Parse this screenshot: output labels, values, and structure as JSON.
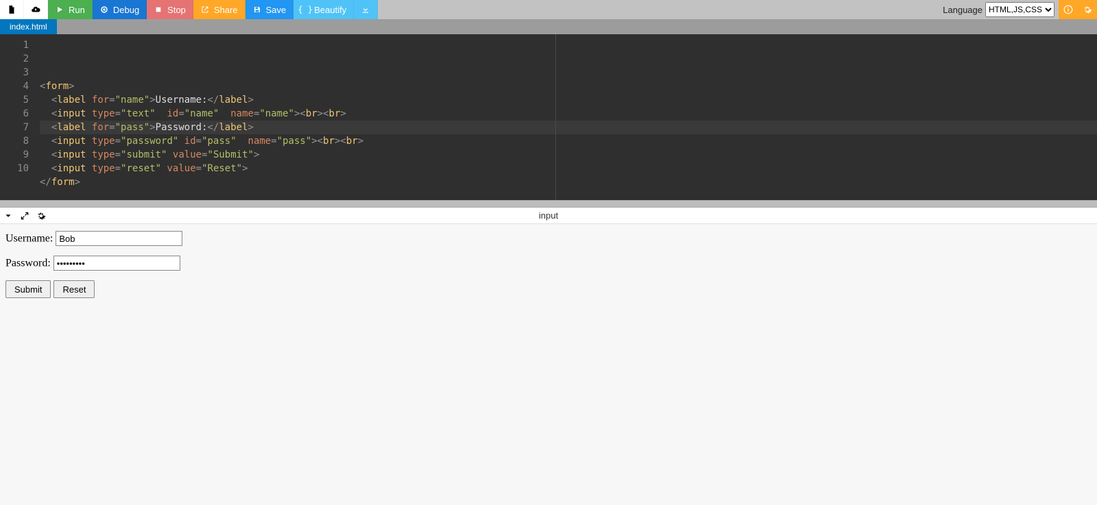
{
  "toolbar": {
    "run": "Run",
    "debug": "Debug",
    "stop": "Stop",
    "share": "Share",
    "save": "Save",
    "beautify": "Beautify",
    "language_label": "Language",
    "language_value": "HTML,JS,CSS"
  },
  "tab": {
    "filename": "index.html"
  },
  "editor": {
    "lines": [
      "1",
      "2",
      "3",
      "4",
      "5",
      "6",
      "7",
      "8",
      "9",
      "10"
    ],
    "code": [
      [
        [
          "t-punc",
          "<"
        ],
        [
          "t-tag",
          "form"
        ],
        [
          "t-punc",
          ">"
        ]
      ],
      [
        [
          "t-text",
          "  "
        ],
        [
          "t-punc",
          "<"
        ],
        [
          "t-tag",
          "label"
        ],
        [
          "t-text",
          " "
        ],
        [
          "t-attr",
          "for"
        ],
        [
          "t-punc",
          "="
        ],
        [
          "t-str",
          "\"name\""
        ],
        [
          "t-punc",
          ">"
        ],
        [
          "t-text",
          "Username:"
        ],
        [
          "t-punc",
          "</"
        ],
        [
          "t-tag",
          "label"
        ],
        [
          "t-punc",
          ">"
        ]
      ],
      [
        [
          "t-text",
          "  "
        ],
        [
          "t-punc",
          "<"
        ],
        [
          "t-tag",
          "input"
        ],
        [
          "t-text",
          " "
        ],
        [
          "t-attr",
          "type"
        ],
        [
          "t-punc",
          "="
        ],
        [
          "t-str",
          "\"text\""
        ],
        [
          "t-text",
          "  "
        ],
        [
          "t-attr",
          "id"
        ],
        [
          "t-punc",
          "="
        ],
        [
          "t-str",
          "\"name\""
        ],
        [
          "t-text",
          "  "
        ],
        [
          "t-attr",
          "name"
        ],
        [
          "t-punc",
          "="
        ],
        [
          "t-str",
          "\"name\""
        ],
        [
          "t-punc",
          "><"
        ],
        [
          "t-tag",
          "br"
        ],
        [
          "t-punc",
          "><"
        ],
        [
          "t-tag",
          "br"
        ],
        [
          "t-punc",
          ">"
        ]
      ],
      [
        [
          "t-text",
          "  "
        ],
        [
          "t-punc",
          "<"
        ],
        [
          "t-tag",
          "label"
        ],
        [
          "t-text",
          " "
        ],
        [
          "t-attr",
          "for"
        ],
        [
          "t-punc",
          "="
        ],
        [
          "t-str",
          "\"pass\""
        ],
        [
          "t-punc",
          ">"
        ],
        [
          "t-text",
          "Password:"
        ],
        [
          "t-punc",
          "</"
        ],
        [
          "t-tag",
          "label"
        ],
        [
          "t-punc",
          ">"
        ]
      ],
      [
        [
          "t-text",
          "  "
        ],
        [
          "t-punc",
          "<"
        ],
        [
          "t-tag",
          "input"
        ],
        [
          "t-text",
          " "
        ],
        [
          "t-attr",
          "type"
        ],
        [
          "t-punc",
          "="
        ],
        [
          "t-str",
          "\"password\""
        ],
        [
          "t-text",
          " "
        ],
        [
          "t-attr",
          "id"
        ],
        [
          "t-punc",
          "="
        ],
        [
          "t-str",
          "\"pass\""
        ],
        [
          "t-text",
          "  "
        ],
        [
          "t-attr",
          "name"
        ],
        [
          "t-punc",
          "="
        ],
        [
          "t-str",
          "\"pass\""
        ],
        [
          "t-punc",
          "><"
        ],
        [
          "t-tag",
          "br"
        ],
        [
          "t-punc",
          "><"
        ],
        [
          "t-tag",
          "br"
        ],
        [
          "t-punc",
          ">"
        ]
      ],
      [
        [
          "t-text",
          "  "
        ],
        [
          "t-punc",
          "<"
        ],
        [
          "t-tag",
          "input"
        ],
        [
          "t-text",
          " "
        ],
        [
          "t-attr",
          "type"
        ],
        [
          "t-punc",
          "="
        ],
        [
          "t-str",
          "\"submit\""
        ],
        [
          "t-text",
          " "
        ],
        [
          "t-attr",
          "value"
        ],
        [
          "t-punc",
          "="
        ],
        [
          "t-str",
          "\"Submit\""
        ],
        [
          "t-punc",
          ">"
        ]
      ],
      [
        [
          "t-text",
          "  "
        ],
        [
          "t-punc",
          "<"
        ],
        [
          "t-tag",
          "input"
        ],
        [
          "t-text",
          " "
        ],
        [
          "t-attr",
          "type"
        ],
        [
          "t-punc",
          "="
        ],
        [
          "t-str",
          "\"reset\""
        ],
        [
          "t-text",
          " "
        ],
        [
          "t-attr",
          "value"
        ],
        [
          "t-punc",
          "="
        ],
        [
          "t-str",
          "\"Reset\""
        ],
        [
          "t-punc",
          ">"
        ]
      ],
      [
        [
          "t-punc",
          "</"
        ],
        [
          "t-tag",
          "form"
        ],
        [
          "t-punc",
          ">"
        ]
      ],
      [],
      []
    ],
    "highlight_row": 3
  },
  "output_header": {
    "title": "input"
  },
  "form": {
    "username_label": "Username:",
    "username_value": "Bob",
    "password_label": "Password:",
    "password_value": "password!",
    "submit": "Submit",
    "reset": "Reset"
  }
}
